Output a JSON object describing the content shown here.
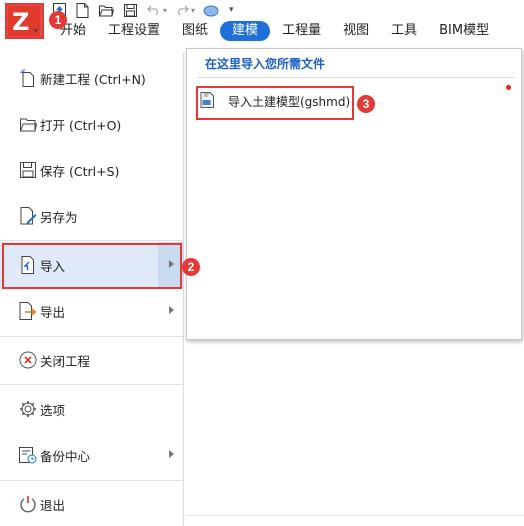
{
  "ribbon": {
    "tabs": [
      "开始",
      "工程设置",
      "图纸",
      "建模",
      "工程量",
      "视图",
      "工具",
      "BIM模型"
    ],
    "active_tab_index": 3,
    "accent_color": "#1e6fd9",
    "quick_access_icons": [
      "upload-icon",
      "new-file-icon",
      "open-folder-icon",
      "save-icon",
      "undo-icon",
      "redo-icon",
      "cloud-icon",
      "customize-icon"
    ]
  },
  "app_button": {
    "logo_letter": "Z",
    "color": "#e2392d"
  },
  "menu": {
    "items": [
      {
        "name": "new-project",
        "label": "新建工程 (Ctrl+N)",
        "icon": "new-file-icon"
      },
      {
        "name": "open",
        "label": "打开 (Ctrl+O)",
        "icon": "folder-icon"
      },
      {
        "name": "save",
        "label": "保存 (Ctrl+S)",
        "icon": "save-icon"
      },
      {
        "name": "save-as",
        "label": "另存为",
        "icon": "save-as-icon"
      },
      {
        "name": "import",
        "label": "导入",
        "icon": "import-icon",
        "has_submenu": true
      },
      {
        "name": "export",
        "label": "导出",
        "icon": "export-icon",
        "has_submenu": true
      },
      {
        "name": "close-project",
        "label": "关闭工程",
        "icon": "close-circle-icon"
      },
      {
        "name": "options",
        "label": "选项",
        "icon": "gear-icon"
      },
      {
        "name": "backup-center",
        "label": "备份中心",
        "icon": "backup-icon",
        "has_submenu": true
      },
      {
        "name": "exit",
        "label": "退出",
        "icon": "power-icon"
      }
    ],
    "hovered_item": "导入"
  },
  "import_submenu": {
    "title": "在这里导入您所需文件",
    "items": [
      {
        "label": "导入土建模型(gshmd)",
        "icon": "model-file-icon"
      }
    ]
  },
  "callouts": [
    "1",
    "2",
    "3"
  ],
  "callout_color": "#e53935"
}
